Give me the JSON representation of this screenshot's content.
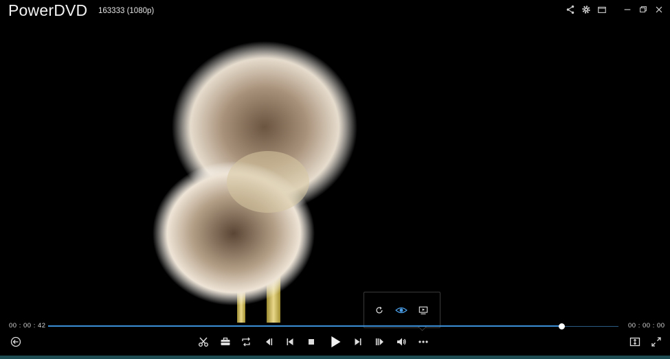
{
  "app": {
    "title": "PowerDVD",
    "file_title": "163333 (1080p)"
  },
  "window_controls": [
    "share-icon",
    "settings-icon",
    "mini-player-icon",
    "minimize-icon",
    "restore-icon",
    "close-icon"
  ],
  "playback": {
    "elapsed": "00 : 00 : 42",
    "remaining": "00 : 00 : 00",
    "progress_fraction": 0.9
  },
  "controls": [
    "back-icon",
    "cut-icon",
    "toolbox-icon",
    "ab-repeat-icon",
    "slow-motion-icon",
    "previous-icon",
    "stop-icon",
    "play-icon",
    "next-icon",
    "frame-step-icon",
    "volume-icon",
    "more-icon",
    "aspect-ratio-icon",
    "fullscreen-icon"
  ],
  "more_popup": [
    "rotate-icon",
    "eye-icon",
    "cast-icon"
  ],
  "colors": {
    "accent": "#3a8fd6",
    "eye_active": "#4a9ee8",
    "background": "#000000"
  }
}
